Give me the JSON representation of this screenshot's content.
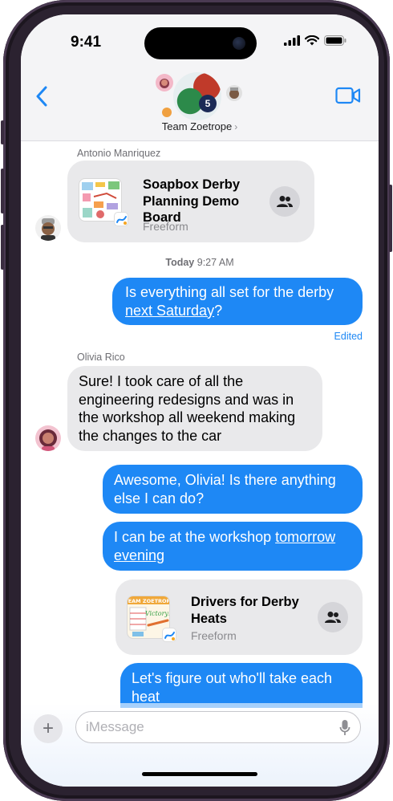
{
  "status_bar": {
    "time": "9:41"
  },
  "nav": {
    "group_name": "Team Zoetrope",
    "group_chevron": "›",
    "group_avatar_badge": "5",
    "back_icon": "chevron-left-icon",
    "video_icon": "video-camera-icon"
  },
  "messages": {
    "sender_antonio": "Antonio Manriquez",
    "card1": {
      "title": "Soapbox Derby Planning Demo Board",
      "subtitle": "Freeform"
    },
    "timestamp_day": "Today",
    "timestamp_time": "9:27 AM",
    "out1_text": "Is everything all set for the derby ",
    "out1_link": "next Saturday",
    "out1_end": "?",
    "edited_label": "Edited",
    "sender_olivia": "Olivia Rico",
    "in1_text": "Sure! I took care of all the engineering redesigns and was in the workshop all weekend making the changes to the car",
    "out2_text": "Awesome, Olivia! Is there anything else I can do?",
    "out3_text": "I can be at the workshop ",
    "out3_link": "tomorrow evening",
    "card2": {
      "title": "Drivers for Derby Heats",
      "subtitle": "Freeform",
      "thumb_text": "TEAM ZOETROPE",
      "thumb_word": "Victory!"
    },
    "out4_text": "Let's figure out who'll take each heat"
  },
  "composer": {
    "placeholder": "iMessage",
    "plus_label": "+"
  },
  "colors": {
    "blue_bubble": "#1e88f5",
    "gray_bubble": "#e9e9eb",
    "accent": "#1e88f5"
  }
}
